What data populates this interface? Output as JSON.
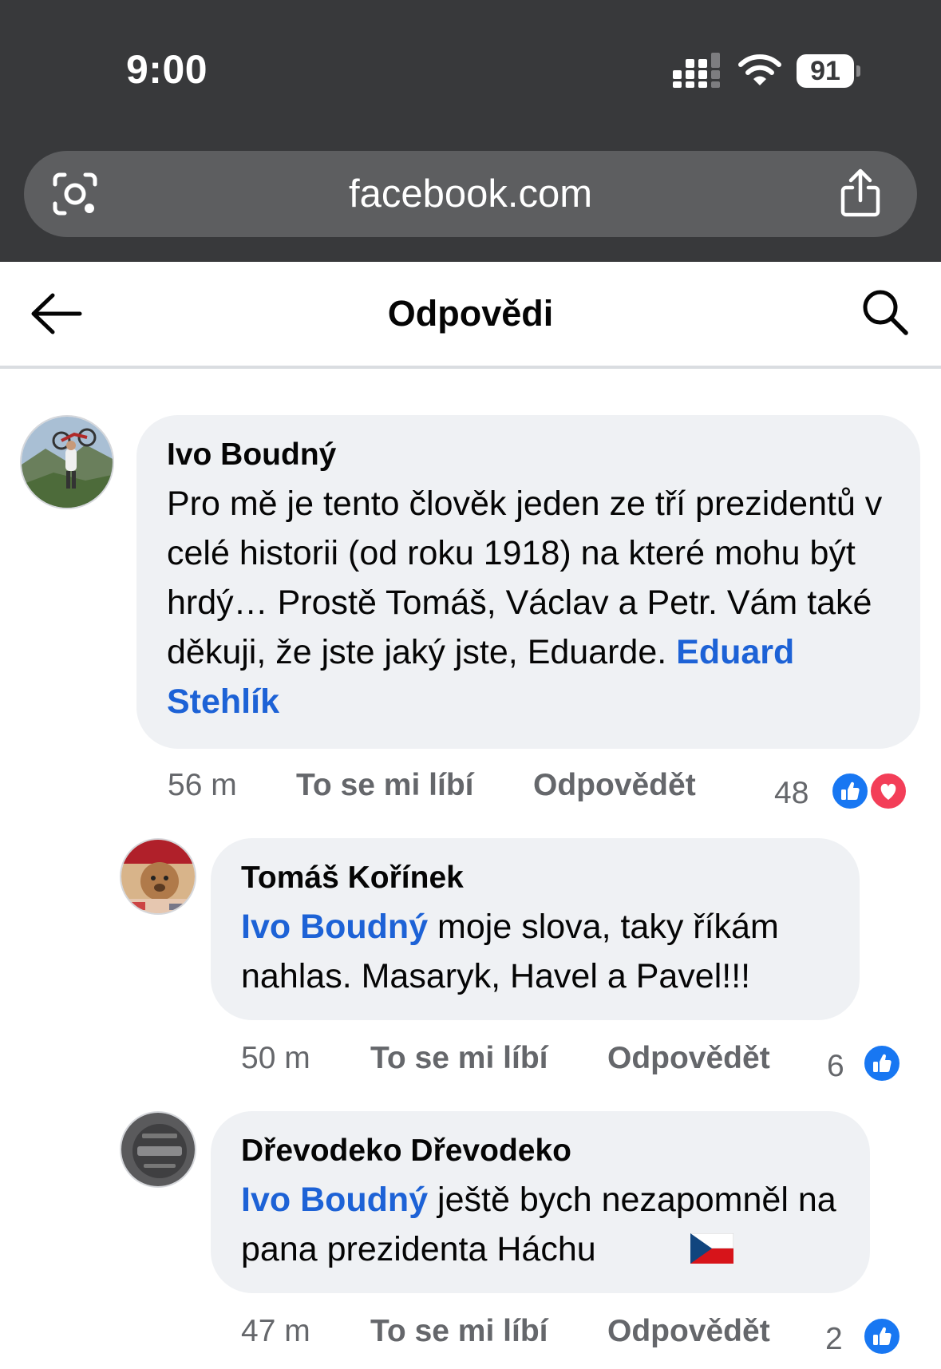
{
  "status_bar": {
    "time": "9:00",
    "battery": "91"
  },
  "browser": {
    "url": "facebook.com"
  },
  "header": {
    "title": "Odpovědi"
  },
  "comments": [
    {
      "author": "Ivo Boudný",
      "text": "Pro mě je tento člověk jeden ze tří prezidentů v celé historii (od roku 1918) na které mohu být hrdý… Prostě Tomáš, Václav a Petr. Vám také děkuji, že jste jaký jste, Eduarde.",
      "mention_end": "Eduard Stehlík",
      "time": "56 m",
      "like_label": "To se mi líbí",
      "reply_label": "Odpovědět",
      "reactions": "48"
    },
    {
      "author": "Tomáš Kořínek",
      "mention_start": "Ivo Boudný",
      "text": " moje slova, taky říkám nahlas. Masaryk, Havel a Pavel!!!",
      "time": "50 m",
      "like_label": "To se mi líbí",
      "reply_label": "Odpovědět",
      "reactions": "6"
    },
    {
      "author": "Dřevodeko Dřevodeko",
      "mention_start": "Ivo Boudný",
      "text": " ještě bych nezapomněl na pana prezidenta Háchu",
      "time": "47 m",
      "like_label": "To se mi líbí",
      "reply_label": "Odpovědět",
      "reactions": "2"
    }
  ],
  "icons": {
    "signal": "signal-icon",
    "wifi": "wifi-icon",
    "lens": "lens-icon",
    "share": "share-icon",
    "back": "back-arrow-icon",
    "search": "search-icon",
    "like": "like-icon",
    "love": "love-icon",
    "flag": "czech-flag-icon"
  },
  "colors": {
    "top_bar": "#38393b",
    "mention": "#1d62d6",
    "like": "#1877f2",
    "love": "#f33e58",
    "bubble": "#eff1f4"
  }
}
